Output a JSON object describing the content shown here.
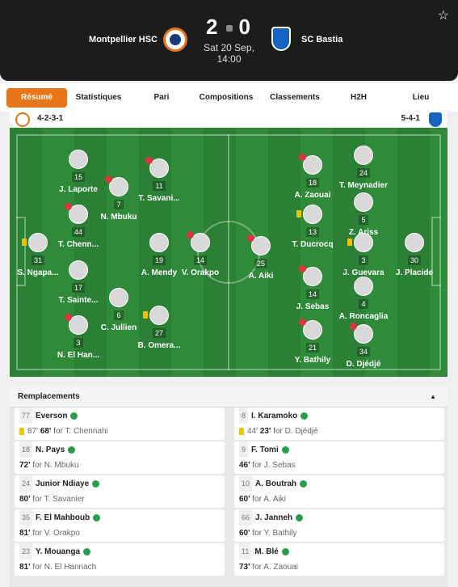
{
  "header": {
    "home_team": "Montpellier HSC",
    "away_team": "SC Bastia",
    "home_score": "2",
    "away_score": "0",
    "date_line1": "Sat 20 Sep,",
    "date_line2": "14:00"
  },
  "tabs": [
    "Résumé",
    "Statistiques",
    "Pari",
    "Compositions",
    "Classements",
    "H2H",
    "Lieu"
  ],
  "lineup": {
    "home_formation": "4-2-3-1",
    "away_formation": "5-4-1",
    "home_players": [
      {
        "number": "15",
        "name": "J. Laporte"
      },
      {
        "number": "11",
        "name": "T. Savani..."
      },
      {
        "number": "7",
        "name": "N. Mbuku"
      },
      {
        "number": "44",
        "name": "T. Chenn..."
      },
      {
        "number": "31",
        "name": "S. Ngapa..."
      },
      {
        "number": "19",
        "name": "A. Mendy"
      },
      {
        "number": "14",
        "name": "V. Orakpo"
      },
      {
        "number": "17",
        "name": "T. Sainte..."
      },
      {
        "number": "6",
        "name": "C. Jullien"
      },
      {
        "number": "27",
        "name": "B. Omera..."
      },
      {
        "number": "3",
        "name": "N. El Han..."
      }
    ],
    "away_players": [
      {
        "number": "18",
        "name": "A. Zaouai"
      },
      {
        "number": "24",
        "name": "T. Meynadier"
      },
      {
        "number": "5",
        "name": "Z. Ariss"
      },
      {
        "number": "13",
        "name": "T. Ducrocq"
      },
      {
        "number": "25",
        "name": "A. Aiki"
      },
      {
        "number": "3",
        "name": "J. Guevara"
      },
      {
        "number": "30",
        "name": "J. Placide"
      },
      {
        "number": "14",
        "name": "J. Sebas"
      },
      {
        "number": "4",
        "name": "A. Roncaglia"
      },
      {
        "number": "21",
        "name": "Y. Bathily"
      },
      {
        "number": "34",
        "name": "D. Djédjé"
      }
    ]
  },
  "substitutions": {
    "title": "Remplacements",
    "home": [
      {
        "number": "77",
        "player_in": "Everson",
        "minute": "68'",
        "extra": "87'",
        "for_label": "for",
        "player_out": "T. Chennahi"
      },
      {
        "number": "18",
        "player_in": "N. Pays",
        "minute": "72'",
        "extra": "",
        "for_label": "for",
        "player_out": "N. Mbuku"
      },
      {
        "number": "24",
        "player_in": "Junior Ndiaye",
        "minute": "80'",
        "extra": "",
        "for_label": "for",
        "player_out": "T. Savanier"
      },
      {
        "number": "35",
        "player_in": "F. El Mahboub",
        "minute": "81'",
        "extra": "",
        "for_label": "for",
        "player_out": "V. Orakpo"
      },
      {
        "number": "23",
        "player_in": "Y. Mouanga",
        "minute": "81'",
        "extra": "",
        "for_label": "for",
        "player_out": "N. El Hannach"
      }
    ],
    "away": [
      {
        "number": "8",
        "player_in": "I. Karamoko",
        "minute": "23'",
        "extra": "44'",
        "for_label": "for",
        "player_out": "D. Djédjé"
      },
      {
        "number": "9",
        "player_in": "F. Tomi",
        "minute": "46'",
        "extra": "",
        "for_label": "for",
        "player_out": "J. Sebas"
      },
      {
        "number": "10",
        "player_in": "A. Boutrah",
        "minute": "60'",
        "extra": "",
        "for_label": "for",
        "player_out": "A. Aiki"
      },
      {
        "number": "66",
        "player_in": "J. Janneh",
        "minute": "60'",
        "extra": "",
        "for_label": "for",
        "player_out": "Y. Bathily"
      },
      {
        "number": "11",
        "player_in": "M. Blé",
        "minute": "73'",
        "extra": "",
        "for_label": "for",
        "player_out": "A. Zaouai"
      }
    ]
  },
  "colors": {
    "accent": "#e8751a",
    "pitch": "#2f8a3a",
    "sub_icon": "#2a9d4a",
    "card": "#f2c200",
    "heart": "#d9363e"
  },
  "icons": {
    "favorite": "star-icon",
    "sub": "substitution-arrow-icon",
    "collapse": "chevron-up-icon"
  }
}
